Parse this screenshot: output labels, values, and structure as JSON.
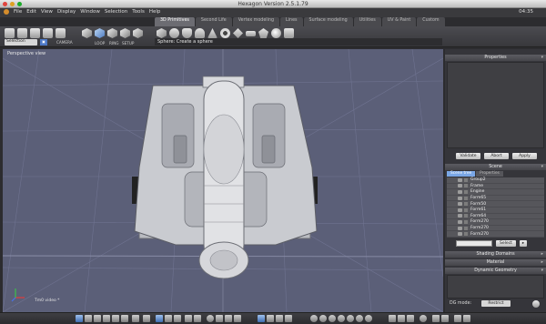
{
  "window": {
    "title": "Hexagon Version 2.5.1.79",
    "clock": "04:35"
  },
  "menu": [
    "File",
    "Edit",
    "View",
    "Display",
    "Window",
    "Selection",
    "Tools",
    "Help"
  ],
  "tabs": [
    "3D Primitives",
    "Second Life",
    "Vertex modeling",
    "Lines",
    "Surface modeling",
    "Utilities",
    "UV & Paint",
    "Custom"
  ],
  "active_tab": 0,
  "toolbar": {
    "selection_label": "Selection",
    "camera_label": "CAMERA",
    "loop_label": "LOOP",
    "ring_label": "RING",
    "setup_label": "SETUP",
    "tip": "Sphere: Create a sphere"
  },
  "viewport": {
    "label": "Perspective view",
    "scene_label": "Tm0 video *"
  },
  "properties": {
    "title": "Properties",
    "buttons": {
      "validate": "Validate",
      "abort": "Abort",
      "apply": "Apply"
    }
  },
  "scene": {
    "title": "Scene",
    "subtabs": [
      "Scene tree",
      "Properties"
    ],
    "items": [
      "Group2",
      "Frame",
      "Engine",
      "Form65",
      "Form50",
      "Form61",
      "Form64",
      "Form270",
      "Form270",
      "Form270"
    ],
    "select_label": "Select"
  },
  "panels": {
    "shading": "Shading Domains",
    "material": "Material",
    "dynamic": "Dynamic Geometry"
  },
  "dg": {
    "mode_label": "DG mode:",
    "mode_value": "Restrict"
  },
  "colors": {
    "viewport_bg": "#5b5f78",
    "accent": "#4a6ea8"
  }
}
